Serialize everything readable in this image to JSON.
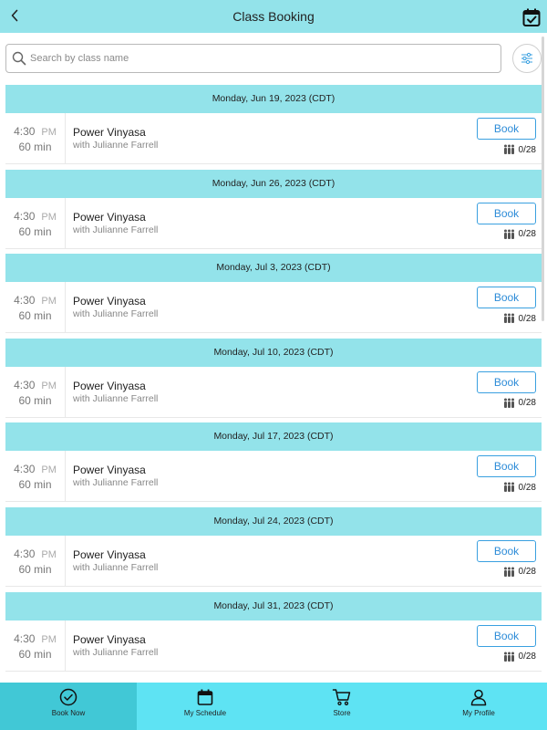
{
  "header": {
    "title": "Class Booking",
    "back_icon": "chevron-left-icon",
    "calendar_icon": "calendar-check-icon"
  },
  "search": {
    "placeholder": "Search by class name",
    "value": "",
    "filter_icon": "sliders-icon"
  },
  "classes": [
    {
      "date": "Monday, Jun 19, 2023 (CDT)",
      "time": "4:30",
      "ampm": "PM",
      "duration": "60 min",
      "name": "Power Vinyasa",
      "instructor": "with Julianne Farrell",
      "book_label": "Book",
      "capacity": "0/28"
    },
    {
      "date": "Monday, Jun 26, 2023 (CDT)",
      "time": "4:30",
      "ampm": "PM",
      "duration": "60 min",
      "name": "Power Vinyasa",
      "instructor": "with Julianne Farrell",
      "book_label": "Book",
      "capacity": "0/28"
    },
    {
      "date": "Monday, Jul 3, 2023 (CDT)",
      "time": "4:30",
      "ampm": "PM",
      "duration": "60 min",
      "name": "Power Vinyasa",
      "instructor": "with Julianne Farrell",
      "book_label": "Book",
      "capacity": "0/28"
    },
    {
      "date": "Monday, Jul 10, 2023 (CDT)",
      "time": "4:30",
      "ampm": "PM",
      "duration": "60 min",
      "name": "Power Vinyasa",
      "instructor": "with Julianne Farrell",
      "book_label": "Book",
      "capacity": "0/28"
    },
    {
      "date": "Monday, Jul 17, 2023 (CDT)",
      "time": "4:30",
      "ampm": "PM",
      "duration": "60 min",
      "name": "Power Vinyasa",
      "instructor": "with Julianne Farrell",
      "book_label": "Book",
      "capacity": "0/28"
    },
    {
      "date": "Monday, Jul 24, 2023 (CDT)",
      "time": "4:30",
      "ampm": "PM",
      "duration": "60 min",
      "name": "Power Vinyasa",
      "instructor": "with Julianne Farrell",
      "book_label": "Book",
      "capacity": "0/28"
    },
    {
      "date": "Monday, Jul 31, 2023 (CDT)",
      "time": "4:30",
      "ampm": "PM",
      "duration": "60 min",
      "name": "Power Vinyasa",
      "instructor": "with Julianne Farrell",
      "book_label": "Book",
      "capacity": "0/28"
    }
  ],
  "tabbar": {
    "tabs": [
      {
        "label": "Book Now",
        "icon": "check-circle-icon",
        "active": true
      },
      {
        "label": "My Schedule",
        "icon": "calendar-icon",
        "active": false
      },
      {
        "label": "Store",
        "icon": "cart-icon",
        "active": false
      },
      {
        "label": "My Profile",
        "icon": "user-icon",
        "active": false
      }
    ]
  },
  "colors": {
    "header_bg": "#93e3ea",
    "tabbar_bg": "#5ee3f3",
    "tab_active_bg": "#41c8d6",
    "book_button_border": "#3aa0e0"
  }
}
